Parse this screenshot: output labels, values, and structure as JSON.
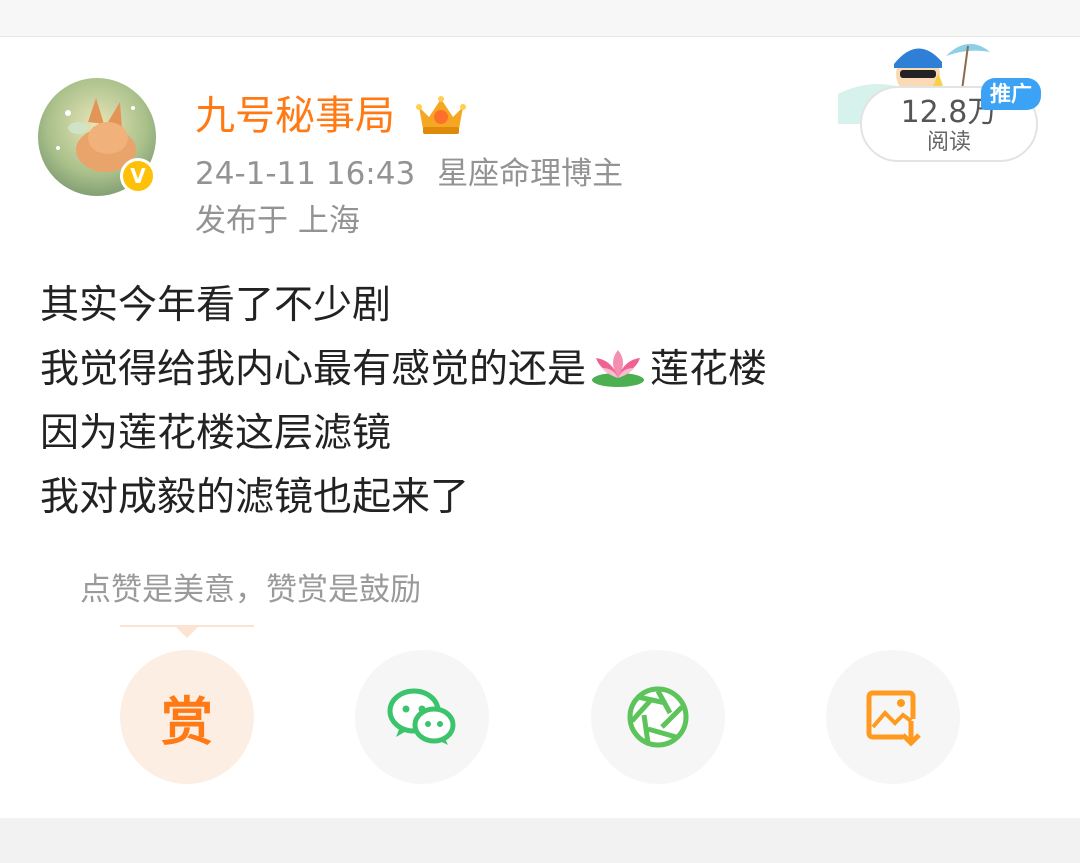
{
  "author": {
    "name": "九号秘事局",
    "timestamp": "24-1-11 16:43",
    "tag": "星座命理博主",
    "location": "发布于 上海",
    "verified_mark": "V"
  },
  "stats": {
    "reads_value": "12.8万",
    "reads_label": "阅读",
    "ad_label": "推广"
  },
  "post": {
    "lines": [
      "其实今年看了不少剧",
      "我觉得给我内心最有感觉的还是",
      "因为莲花楼这层滤镜",
      "我对成毅的滤镜也起来了"
    ],
    "line2_suffix": "莲花楼"
  },
  "reward": {
    "tip": "点赞是美意，赞赏是鼓励",
    "reward_label": "赏"
  },
  "colors": {
    "accent_orange": "#ff7a14",
    "wechat_green": "#3cc46c",
    "moments_green": "#5cc45a",
    "save_orange": "#ff9a1e",
    "ad_blue": "#3ba2f5",
    "verified_yellow": "#ffc107"
  },
  "icons": [
    "crown-badge-icon",
    "lotus-emoji-icon",
    "wechat-icon",
    "moments-icon",
    "save-image-icon",
    "mascot-icon"
  ]
}
